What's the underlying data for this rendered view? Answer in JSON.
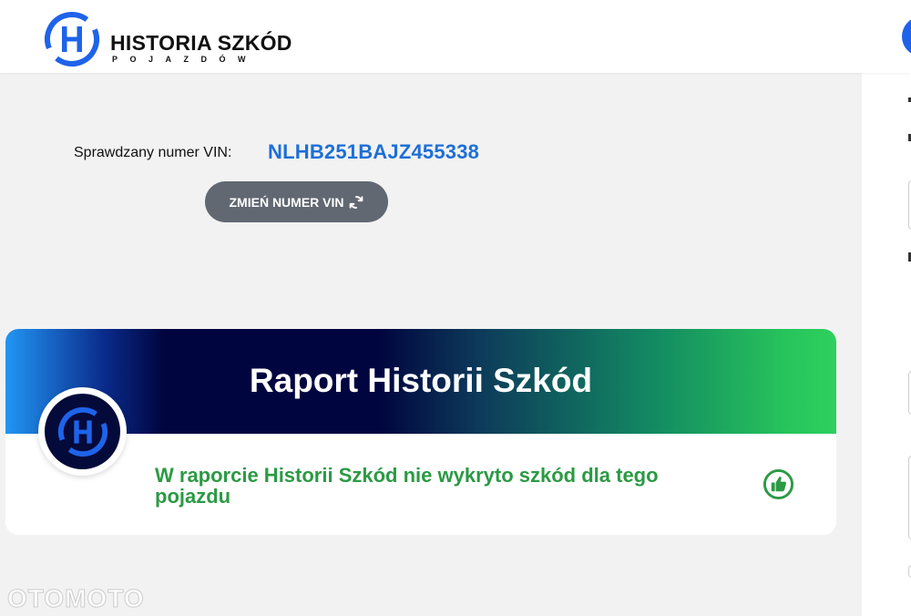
{
  "header": {
    "logo_title": "HISTORIA SZKÓD",
    "logo_subtitle": "POJAZDÓW"
  },
  "vin": {
    "label": "Sprawdzany numer VIN:",
    "value": "NLHB251BAJZ455338",
    "change_button_label": "ZMIEŃ NUMER VIN",
    "change_button_icon": "refresh-icon"
  },
  "report": {
    "title": "Raport Historii Szkód",
    "message": "W raporcie Historii Szkód nie wykryto szkód dla tego pojazdu",
    "status_icon": "thumbs-up-icon"
  },
  "watermark": "OTOMOTO",
  "colors": {
    "accent_blue": "#1d6fd8",
    "logo_blue": "#1e63e9",
    "success_green": "#2b9a44",
    "button_gray": "#616872",
    "banner_navy": "#00053f"
  }
}
